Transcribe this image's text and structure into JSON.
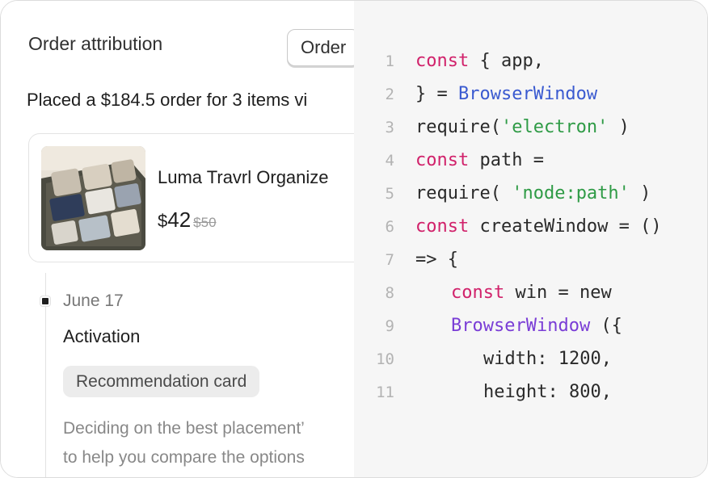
{
  "left_panel": {
    "title": "Order attribution",
    "order_button": "Order",
    "placed_text": "Placed a $184.5 order for 3 items vi",
    "product": {
      "name": "Luma Travrl Organize",
      "currency": "$",
      "price": "42",
      "old_price": "$50"
    },
    "timeline": {
      "date": "June 17",
      "event": "Activation",
      "badge": "Recommendation card",
      "description_line1": "Deciding on the best placement’",
      "description_line2": "to help you compare the options"
    }
  },
  "code_panel": {
    "lines": [
      {
        "n": "1",
        "parts": [
          {
            "t": "const",
            "c": "kw"
          },
          {
            "t": " { app,",
            "c": ""
          }
        ]
      },
      {
        "n": "2",
        "parts": [
          {
            "t": "} = ",
            "c": ""
          },
          {
            "t": "BrowserWindow",
            "c": "ty"
          }
        ]
      },
      {
        "n": "3",
        "parts": [
          {
            "t": "require(",
            "c": ""
          },
          {
            "t": "'electron'",
            "c": "str"
          },
          {
            "t": " )",
            "c": ""
          }
        ]
      },
      {
        "n": "4",
        "parts": [
          {
            "t": "const",
            "c": "kw"
          },
          {
            "t": " path =",
            "c": ""
          }
        ]
      },
      {
        "n": "5",
        "parts": [
          {
            "t": "require( ",
            "c": ""
          },
          {
            "t": "'node:path'",
            "c": "str"
          },
          {
            "t": " )",
            "c": ""
          }
        ]
      },
      {
        "n": "6",
        "parts": [
          {
            "t": "const",
            "c": "kw"
          },
          {
            "t": " createWindow = ()",
            "c": ""
          }
        ]
      },
      {
        "n": "7",
        "parts": [
          {
            "t": "=> {",
            "c": ""
          }
        ]
      },
      {
        "n": "8",
        "indent": 1,
        "parts": [
          {
            "t": "const",
            "c": "kw"
          },
          {
            "t": " win = new",
            "c": ""
          }
        ]
      },
      {
        "n": "9",
        "indent": 1,
        "parts": [
          {
            "t": "BrowserWindow",
            "c": "ty2"
          },
          {
            "t": " ({",
            "c": ""
          }
        ]
      },
      {
        "n": "10",
        "indent": 2,
        "parts": [
          {
            "t": "width: 1200,",
            "c": ""
          }
        ]
      },
      {
        "n": "11",
        "indent": 2,
        "parts": [
          {
            "t": "height: 800,",
            "c": ""
          }
        ]
      }
    ]
  },
  "colors": {
    "keyword": "#d1226b",
    "type": "#3a5ad0",
    "type_alt": "#7a3dd6",
    "string": "#2f9b46",
    "code_background": "#f6f6f6"
  }
}
